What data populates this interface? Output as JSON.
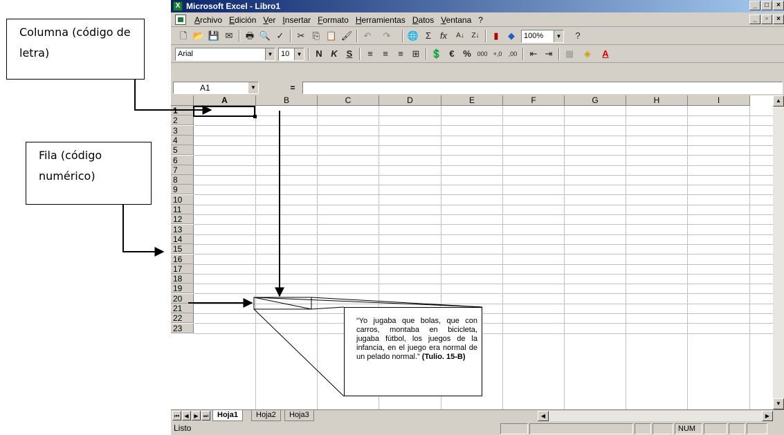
{
  "window": {
    "title": "Microsoft Excel - Libro1",
    "controls": [
      "_",
      "□",
      "×"
    ],
    "doc_controls": [
      "_",
      "▫",
      "×"
    ]
  },
  "menu": [
    "Archivo",
    "Edición",
    "Ver",
    "Insertar",
    "Formato",
    "Herramientas",
    "Datos",
    "Ventana",
    "?"
  ],
  "toolbar": {
    "zoom": "100%",
    "font": "Arial",
    "font_size": "10",
    "bold": "N",
    "italic": "K",
    "underline": "S",
    "euro": "€",
    "percent": "%",
    "thousands": "000"
  },
  "formula_bar": {
    "cell_ref": "A1",
    "equals": "=",
    "value": ""
  },
  "columns": [
    "A",
    "B",
    "C",
    "D",
    "E",
    "F",
    "G",
    "H",
    "I"
  ],
  "rows": [
    "1",
    "2",
    "3",
    "4",
    "5",
    "6",
    "7",
    "8",
    "9",
    "10",
    "11",
    "12",
    "13",
    "14",
    "15",
    "16",
    "17",
    "18",
    "19",
    "20",
    "21",
    "22",
    "23"
  ],
  "sheets": [
    "Hoja1",
    "Hoja2",
    "Hoja3"
  ],
  "status": {
    "ready": "Listo",
    "num": "NUM"
  },
  "annotations": {
    "column_label": "Columna (código de  letra)",
    "row_label": "Fila (código numérico)",
    "quote": "“Yo jugaba que bolas, que con carros, montaba en bicicleta, jugaba fútbol, los juegos de la infancia, en el juego era normal de un pelado normal.”",
    "quote_source": "(Tulio. 15-B)"
  },
  "colors": {
    "title_gradient_start": "#0a246a",
    "title_gradient_end": "#a6caf0",
    "chrome": "#d4d0c8"
  }
}
